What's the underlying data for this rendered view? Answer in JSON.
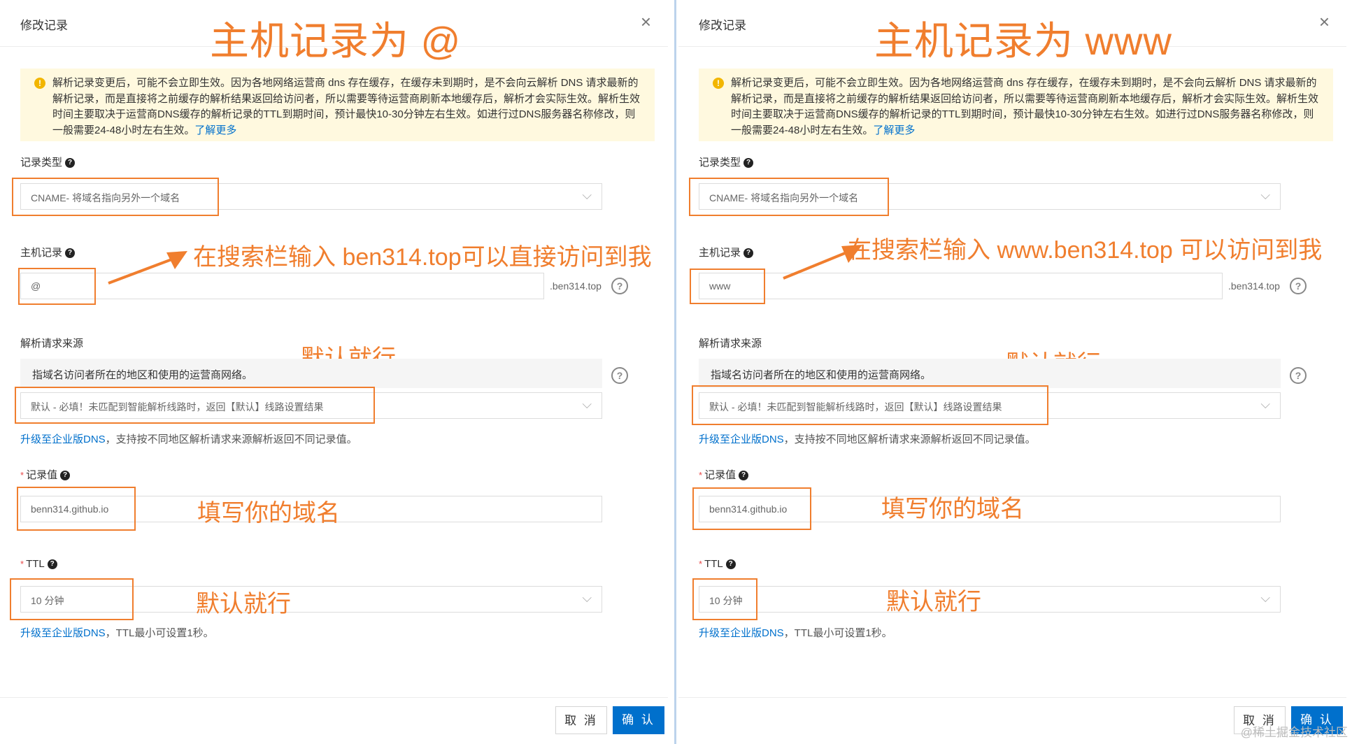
{
  "dialog_title": "修改记录",
  "alert": {
    "text": "解析记录变更后，可能不会立即生效。因为各地网络运营商 dns 存在缓存，在缓存未到期时，是不会向云解析 DNS 请求最新的解析记录，而是直接将之前缓存的解析结果返回给访问者，所以需要等待运营商刷新本地缓存后，解析才会实际生效。解析生效时间主要取决于运营商DNS缓存的解析记录的TTL到期时间，预计最快10-30分钟左右生效。如进行过DNS服务器名称修改，则一般需要24-48小时左右生效。",
    "link": "了解更多"
  },
  "labels": {
    "record_type": "记录类型",
    "host": "主机记录",
    "source": "解析请求来源",
    "value": "记录值",
    "ttl": "TTL"
  },
  "record_type_value": "CNAME- 将域名指向另外一个域名",
  "domain_suffix": ".ben314.top",
  "source_description": "指域名访问者所在的地区和使用的运营商网络。",
  "source_value": "默认 - 必填！未匹配到智能解析线路时，返回【默认】线路设置结果",
  "upgrade_link": "升级至企业版DNS",
  "source_hint": "，支持按不同地区解析请求来源解析返回不同记录值。",
  "record_value": "benn314.github.io",
  "ttl_value": "10 分钟",
  "ttl_hint": "，TTL最小可设置1秒。",
  "buttons": {
    "cancel": "取 消",
    "ok": "确 认"
  },
  "notes": {
    "default_ok": "默认就行",
    "fill_domain": "填写你的域名"
  },
  "left": {
    "big_title": "主机记录为 @",
    "host_value": "@",
    "host_note": "在搜索栏输入 ben314.top可以直接访问到我"
  },
  "right": {
    "big_title": "主机记录为 www",
    "host_value": "www",
    "host_note": "在搜索栏输入 www.ben314.top 可以访问到我"
  },
  "watermark": "@稀土掘金技术社区",
  "colors": {
    "annotation": "#f07e2e",
    "primary": "#0070cc",
    "alert_bg": "#fff9df"
  }
}
